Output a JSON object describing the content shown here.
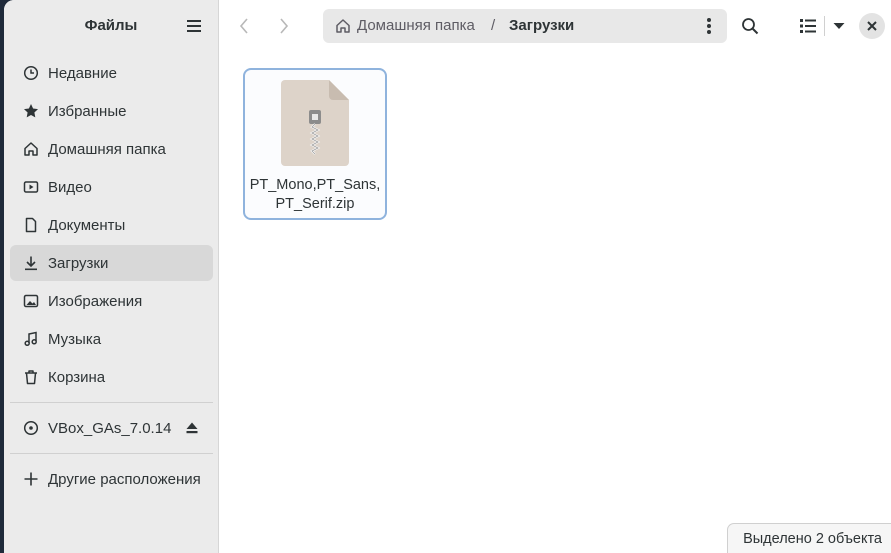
{
  "app": {
    "title": "Файлы"
  },
  "sidebar": {
    "items": [
      {
        "label": "Недавние",
        "icon": "clock-icon"
      },
      {
        "label": "Избранные",
        "icon": "star-icon"
      },
      {
        "label": "Домашняя папка",
        "icon": "home-icon"
      },
      {
        "label": "Видео",
        "icon": "video-icon"
      },
      {
        "label": "Документы",
        "icon": "document-icon"
      },
      {
        "label": "Загрузки",
        "icon": "download-icon",
        "active": true
      },
      {
        "label": "Изображения",
        "icon": "image-icon"
      },
      {
        "label": "Музыка",
        "icon": "music-icon"
      },
      {
        "label": "Корзина",
        "icon": "trash-icon"
      }
    ],
    "devices": [
      {
        "label": "VBox_GAs_7.0.14",
        "icon": "disc-icon",
        "action_icon": "eject-icon"
      }
    ],
    "other": {
      "label": "Другие расположения",
      "icon": "plus-icon"
    }
  },
  "header": {
    "breadcrumbs": [
      "Домашняя папка",
      "Загрузки"
    ],
    "separator": "/",
    "icons": [
      "back-icon",
      "forward-icon",
      "search-icon",
      "list-view-icon",
      "view-options-icon",
      "close-icon"
    ]
  },
  "files": [
    {
      "name_lines": [
        "PT_Mono,PT_Sans,",
        "PT_Serif.zip"
      ],
      "icon": "zip-archive-icon",
      "selected": true
    }
  ],
  "status": {
    "text": "Выделено 2 объекта"
  },
  "colors": {
    "sidebar_bg": "#ebebeb",
    "active_item": "#d8d8d8",
    "selection_border": "#8fb3dd",
    "zip_icon": "#ddd3c9"
  }
}
